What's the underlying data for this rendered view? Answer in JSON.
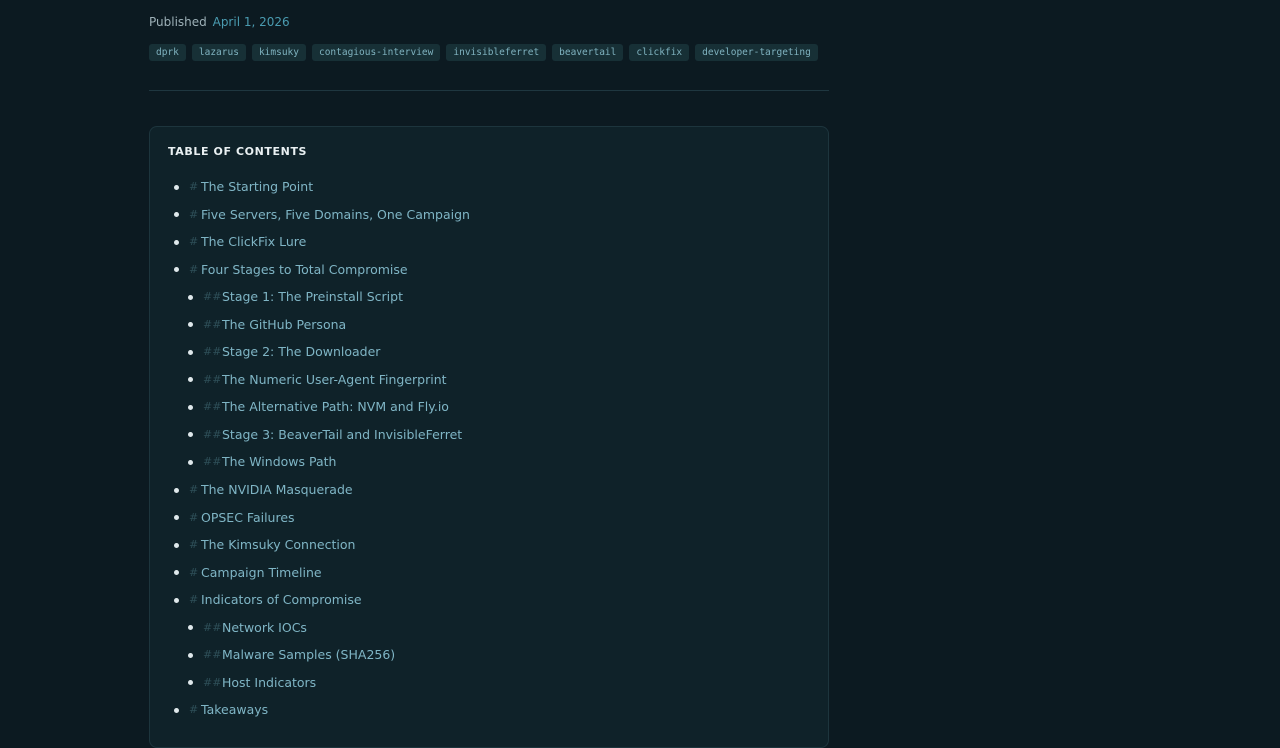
{
  "meta": {
    "published_label": "Published",
    "date": "April 1, 2026"
  },
  "tags": [
    "dprk",
    "lazarus",
    "kimsuky",
    "contagious-interview",
    "invisibleferret",
    "beavertail",
    "clickfix",
    "developer-targeting"
  ],
  "toc": {
    "title": "TABLE OF CONTENTS",
    "items": [
      {
        "level": 1,
        "marker": "#",
        "label": "The Starting Point"
      },
      {
        "level": 1,
        "marker": "#",
        "label": "Five Servers, Five Domains, One Campaign"
      },
      {
        "level": 1,
        "marker": "#",
        "label": "The ClickFix Lure"
      },
      {
        "level": 1,
        "marker": "#",
        "label": "Four Stages to Total Compromise"
      },
      {
        "level": 2,
        "marker": "##",
        "label": "Stage 1: The Preinstall Script"
      },
      {
        "level": 2,
        "marker": "##",
        "label": "The GitHub Persona"
      },
      {
        "level": 2,
        "marker": "##",
        "label": "Stage 2: The Downloader"
      },
      {
        "level": 2,
        "marker": "##",
        "label": "The Numeric User-Agent Fingerprint"
      },
      {
        "level": 2,
        "marker": "##",
        "label": "The Alternative Path: NVM and Fly.io"
      },
      {
        "level": 2,
        "marker": "##",
        "label": "Stage 3: BeaverTail and InvisibleFerret"
      },
      {
        "level": 2,
        "marker": "##",
        "label": "The Windows Path"
      },
      {
        "level": 1,
        "marker": "#",
        "label": "The NVIDIA Masquerade"
      },
      {
        "level": 1,
        "marker": "#",
        "label": "OPSEC Failures"
      },
      {
        "level": 1,
        "marker": "#",
        "label": "The Kimsuky Connection"
      },
      {
        "level": 1,
        "marker": "#",
        "label": "Campaign Timeline"
      },
      {
        "level": 1,
        "marker": "#",
        "label": "Indicators of Compromise"
      },
      {
        "level": 2,
        "marker": "##",
        "label": "Network IOCs"
      },
      {
        "level": 2,
        "marker": "##",
        "label": "Malware Samples (SHA256)"
      },
      {
        "level": 2,
        "marker": "##",
        "label": "Host Indicators"
      },
      {
        "level": 1,
        "marker": "#",
        "label": "Takeaways"
      }
    ]
  },
  "colors": {
    "background": "#0c1a21",
    "panel": "#0f2229",
    "link": "#7fb5c5",
    "tag_bg": "#173036",
    "tag_text": "#7fb2bf"
  }
}
